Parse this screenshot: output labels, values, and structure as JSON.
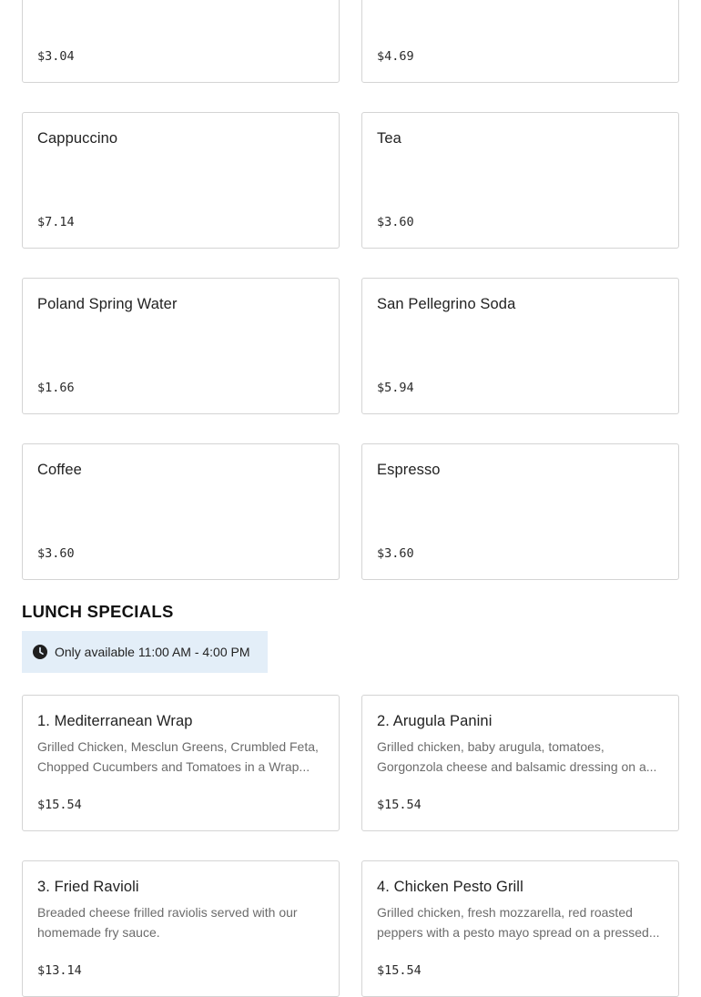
{
  "beverages": [
    {
      "name": "",
      "price": "$3.04"
    },
    {
      "name": "",
      "price": "$4.69"
    },
    {
      "name": "Cappuccino",
      "price": "$7.14"
    },
    {
      "name": "Tea",
      "price": "$3.60"
    },
    {
      "name": "Poland Spring Water",
      "price": "$1.66"
    },
    {
      "name": "San Pellegrino Soda",
      "price": "$5.94"
    },
    {
      "name": "Coffee",
      "price": "$3.60"
    },
    {
      "name": "Espresso",
      "price": "$3.60"
    }
  ],
  "lunch_specials": {
    "title": "LUNCH SPECIALS",
    "availability": "Only available 11:00 AM - 4:00 PM",
    "availability_icon": "clock-icon",
    "availability_bg": "#e3eef8",
    "items": [
      {
        "name": "1. Mediterranean Wrap",
        "description": "Grilled Chicken, Mesclun Greens, Crumbled Feta, Chopped Cucumbers and Tomatoes in a Wrap...",
        "price": "$15.54"
      },
      {
        "name": "2. Arugula Panini",
        "description": "Grilled chicken, baby arugula, tomatoes, Gorgonzola cheese and balsamic dressing on a...",
        "price": "$15.54"
      },
      {
        "name": "3. Fried Ravioli",
        "description": "Breaded cheese frilled raviolis served with our homemade fry sauce.",
        "price": "$13.14"
      },
      {
        "name": "4. Chicken Pesto Grill",
        "description": "Grilled chicken, fresh mozzarella, red roasted peppers with a pesto mayo spread on a pressed...",
        "price": "$15.54"
      }
    ]
  }
}
